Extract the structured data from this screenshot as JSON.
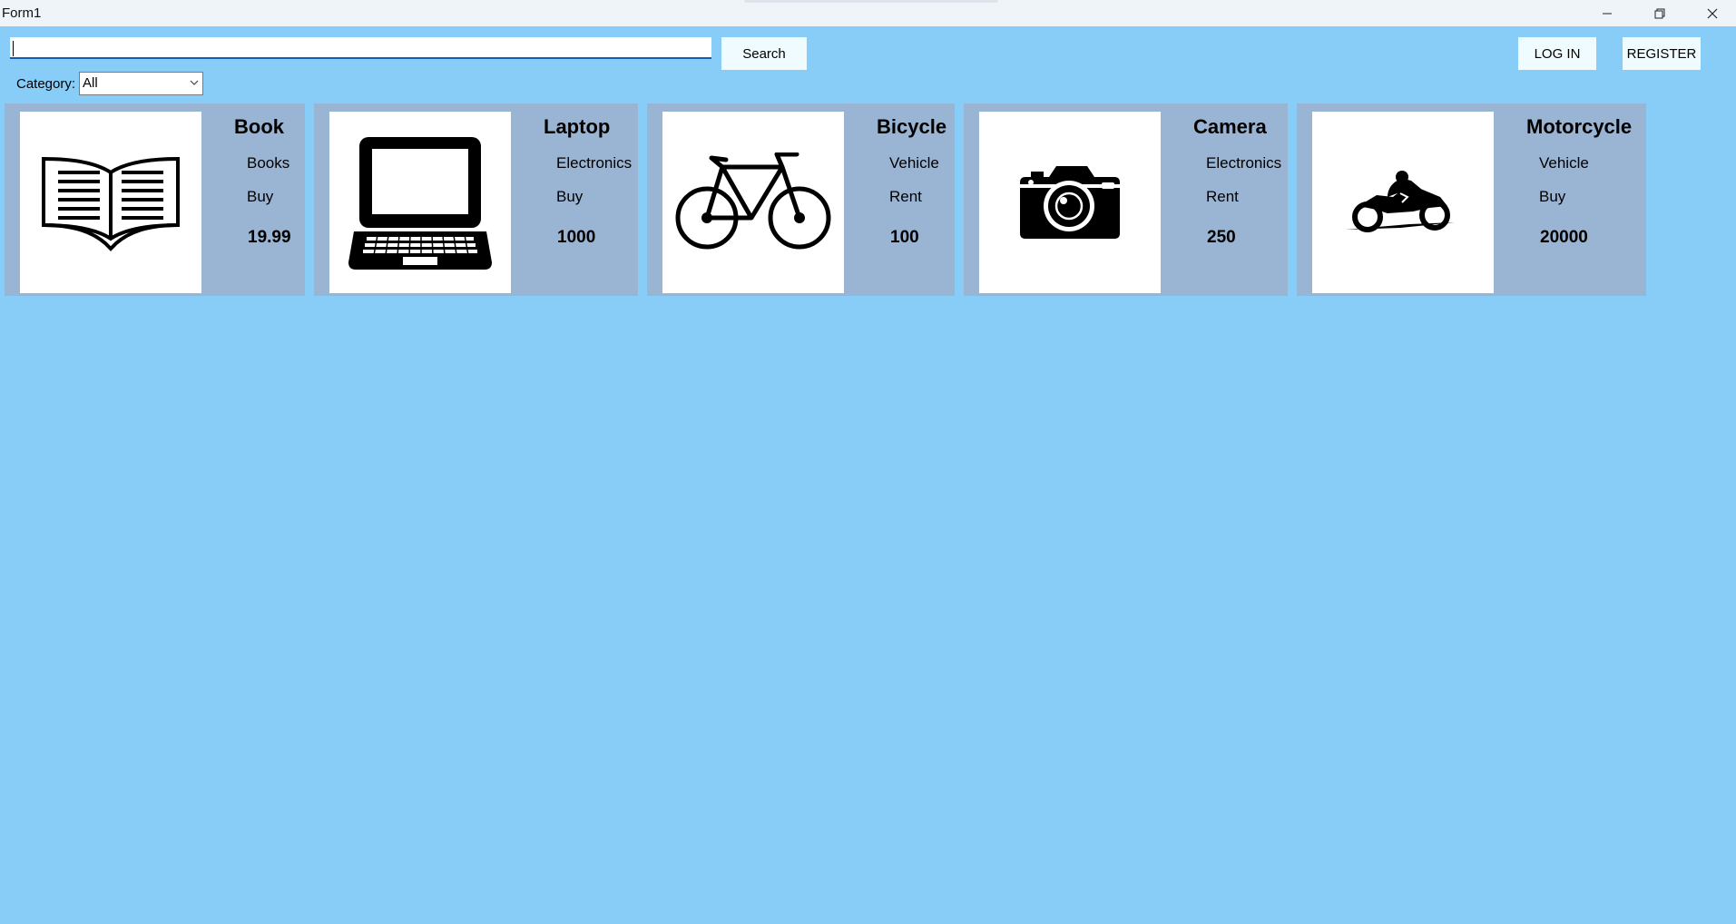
{
  "window": {
    "title": "Form1"
  },
  "toolbar": {
    "search_value": "",
    "search_label": "Search",
    "login_label": "LOG IN",
    "register_label": "REGISTER"
  },
  "filter": {
    "category_label": "Category:",
    "category_value": "All"
  },
  "products": [
    {
      "name": "Book",
      "category": "Books",
      "mode": "Buy",
      "price": "19.99",
      "icon": "open-book-icon"
    },
    {
      "name": "Laptop",
      "category": "Electronics",
      "mode": "Buy",
      "price": "1000",
      "icon": "laptop-icon"
    },
    {
      "name": "Bicycle",
      "category": "Vehicle",
      "mode": "Rent",
      "price": "100",
      "icon": "bicycle-icon"
    },
    {
      "name": "Camera",
      "category": "Electronics",
      "mode": "Rent",
      "price": "250",
      "icon": "camera-icon"
    },
    {
      "name": "Motorcycle",
      "category": "Vehicle",
      "mode": "Buy",
      "price": "20000",
      "icon": "motorcycle-icon"
    }
  ]
}
